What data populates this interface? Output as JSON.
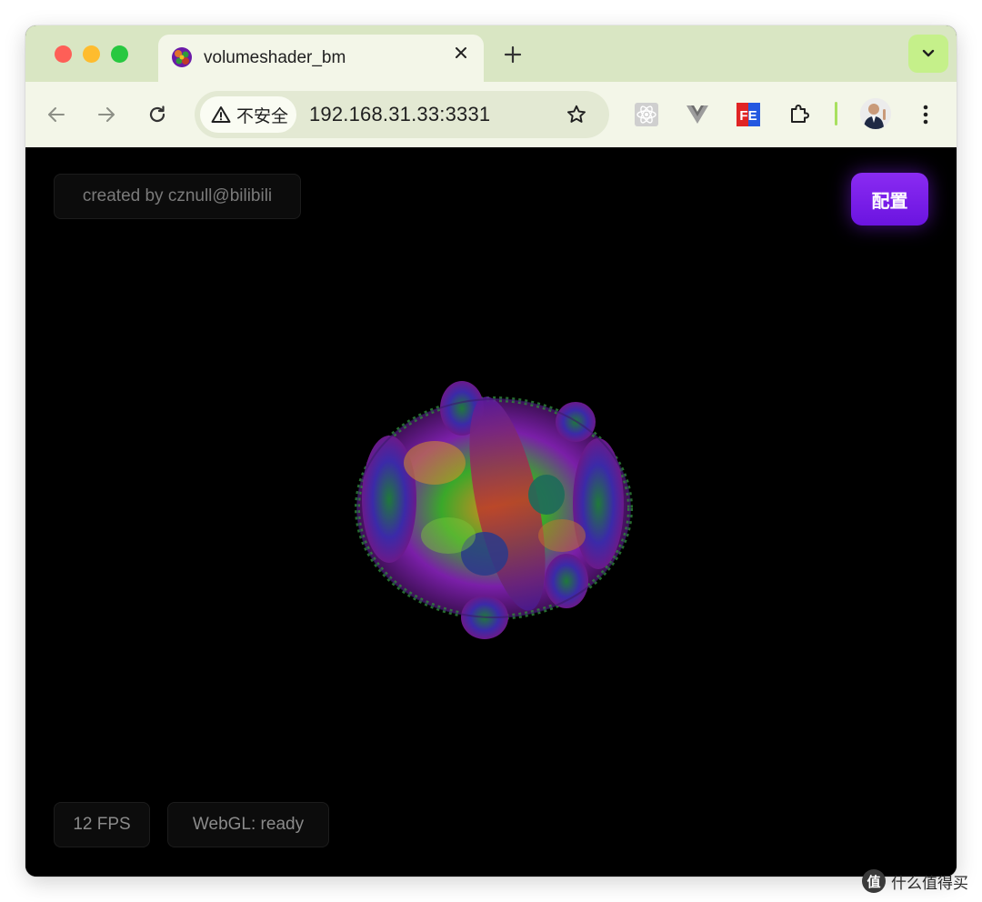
{
  "browser": {
    "tab": {
      "title": "volumeshader_bm"
    },
    "address": {
      "security_label": "不安全",
      "url": "192.168.31.33:3331"
    },
    "extensions": [
      "react-devtools-icon",
      "vue-devtools-icon",
      "fe-helper-icon",
      "extensions-puzzle-icon"
    ],
    "accent_color": "#c5f08a"
  },
  "page": {
    "credit": "created by cznull@bilibili",
    "config_button": "配置",
    "fps": "12 FPS",
    "webgl_status": "WebGL: ready",
    "button_color": "#7a1ee8"
  },
  "watermark": {
    "text": "什么值得买",
    "logo": "值"
  }
}
